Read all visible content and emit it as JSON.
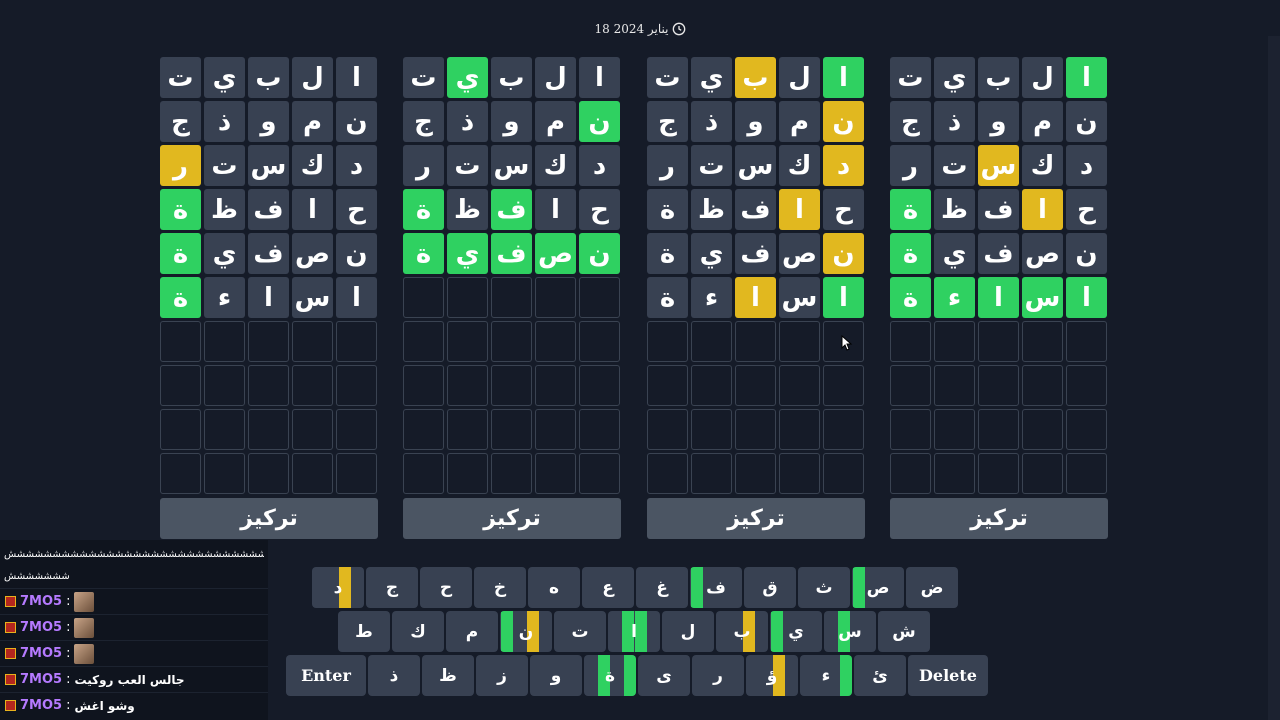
{
  "date": "18 يناير 2024",
  "focus_label": "تركيز",
  "boards": [
    {
      "rows": [
        [
          {
            "l": "ت",
            "s": "a"
          },
          {
            "l": "ي",
            "s": "a"
          },
          {
            "l": "ب",
            "s": "a"
          },
          {
            "l": "ل",
            "s": "a"
          },
          {
            "l": "ا",
            "s": "a"
          }
        ],
        [
          {
            "l": "ج",
            "s": "a"
          },
          {
            "l": "ذ",
            "s": "a"
          },
          {
            "l": "و",
            "s": "a"
          },
          {
            "l": "م",
            "s": "a"
          },
          {
            "l": "ن",
            "s": "a"
          }
        ],
        [
          {
            "l": "ر",
            "s": "y"
          },
          {
            "l": "ت",
            "s": "a"
          },
          {
            "l": "س",
            "s": "a"
          },
          {
            "l": "ك",
            "s": "a"
          },
          {
            "l": "د",
            "s": "a"
          }
        ],
        [
          {
            "l": "ة",
            "s": "g"
          },
          {
            "l": "ظ",
            "s": "a"
          },
          {
            "l": "ف",
            "s": "a"
          },
          {
            "l": "ا",
            "s": "a"
          },
          {
            "l": "ح",
            "s": "a"
          }
        ],
        [
          {
            "l": "ة",
            "s": "g"
          },
          {
            "l": "ي",
            "s": "a"
          },
          {
            "l": "ف",
            "s": "a"
          },
          {
            "l": "ص",
            "s": "a"
          },
          {
            "l": "ن",
            "s": "a"
          }
        ],
        [
          {
            "l": "ة",
            "s": "g"
          },
          {
            "l": "ء",
            "s": "a"
          },
          {
            "l": "ا",
            "s": "a"
          },
          {
            "l": "س",
            "s": "a"
          },
          {
            "l": "ا",
            "s": "a"
          }
        ]
      ]
    },
    {
      "rows": [
        [
          {
            "l": "ت",
            "s": "a"
          },
          {
            "l": "ي",
            "s": "g"
          },
          {
            "l": "ب",
            "s": "a"
          },
          {
            "l": "ل",
            "s": "a"
          },
          {
            "l": "ا",
            "s": "a"
          }
        ],
        [
          {
            "l": "ج",
            "s": "a"
          },
          {
            "l": "ذ",
            "s": "a"
          },
          {
            "l": "و",
            "s": "a"
          },
          {
            "l": "م",
            "s": "a"
          },
          {
            "l": "ن",
            "s": "g"
          }
        ],
        [
          {
            "l": "ر",
            "s": "a"
          },
          {
            "l": "ت",
            "s": "a"
          },
          {
            "l": "س",
            "s": "a"
          },
          {
            "l": "ك",
            "s": "a"
          },
          {
            "l": "د",
            "s": "a"
          }
        ],
        [
          {
            "l": "ة",
            "s": "g"
          },
          {
            "l": "ظ",
            "s": "a"
          },
          {
            "l": "ف",
            "s": "g"
          },
          {
            "l": "ا",
            "s": "a"
          },
          {
            "l": "ح",
            "s": "a"
          }
        ],
        [
          {
            "l": "ة",
            "s": "g"
          },
          {
            "l": "ي",
            "s": "g"
          },
          {
            "l": "ف",
            "s": "g"
          },
          {
            "l": "ص",
            "s": "g"
          },
          {
            "l": "ن",
            "s": "g"
          }
        ]
      ]
    },
    {
      "rows": [
        [
          {
            "l": "ت",
            "s": "a"
          },
          {
            "l": "ي",
            "s": "a"
          },
          {
            "l": "ب",
            "s": "y"
          },
          {
            "l": "ل",
            "s": "a"
          },
          {
            "l": "ا",
            "s": "g"
          }
        ],
        [
          {
            "l": "ج",
            "s": "a"
          },
          {
            "l": "ذ",
            "s": "a"
          },
          {
            "l": "و",
            "s": "a"
          },
          {
            "l": "م",
            "s": "a"
          },
          {
            "l": "ن",
            "s": "y"
          }
        ],
        [
          {
            "l": "ر",
            "s": "a"
          },
          {
            "l": "ت",
            "s": "a"
          },
          {
            "l": "س",
            "s": "a"
          },
          {
            "l": "ك",
            "s": "a"
          },
          {
            "l": "د",
            "s": "y"
          }
        ],
        [
          {
            "l": "ة",
            "s": "a"
          },
          {
            "l": "ظ",
            "s": "a"
          },
          {
            "l": "ف",
            "s": "a"
          },
          {
            "l": "ا",
            "s": "y"
          },
          {
            "l": "ح",
            "s": "a"
          }
        ],
        [
          {
            "l": "ة",
            "s": "a"
          },
          {
            "l": "ي",
            "s": "a"
          },
          {
            "l": "ف",
            "s": "a"
          },
          {
            "l": "ص",
            "s": "a"
          },
          {
            "l": "ن",
            "s": "y"
          }
        ],
        [
          {
            "l": "ة",
            "s": "a"
          },
          {
            "l": "ء",
            "s": "a"
          },
          {
            "l": "ا",
            "s": "y"
          },
          {
            "l": "س",
            "s": "a"
          },
          {
            "l": "ا",
            "s": "g"
          }
        ]
      ]
    },
    {
      "rows": [
        [
          {
            "l": "ت",
            "s": "a"
          },
          {
            "l": "ي",
            "s": "a"
          },
          {
            "l": "ب",
            "s": "a"
          },
          {
            "l": "ل",
            "s": "a"
          },
          {
            "l": "ا",
            "s": "g"
          }
        ],
        [
          {
            "l": "ج",
            "s": "a"
          },
          {
            "l": "ذ",
            "s": "a"
          },
          {
            "l": "و",
            "s": "a"
          },
          {
            "l": "م",
            "s": "a"
          },
          {
            "l": "ن",
            "s": "a"
          }
        ],
        [
          {
            "l": "ر",
            "s": "a"
          },
          {
            "l": "ت",
            "s": "a"
          },
          {
            "l": "س",
            "s": "y"
          },
          {
            "l": "ك",
            "s": "a"
          },
          {
            "l": "د",
            "s": "a"
          }
        ],
        [
          {
            "l": "ة",
            "s": "g"
          },
          {
            "l": "ظ",
            "s": "a"
          },
          {
            "l": "ف",
            "s": "a"
          },
          {
            "l": "ا",
            "s": "y"
          },
          {
            "l": "ح",
            "s": "a"
          }
        ],
        [
          {
            "l": "ة",
            "s": "g"
          },
          {
            "l": "ي",
            "s": "a"
          },
          {
            "l": "ف",
            "s": "a"
          },
          {
            "l": "ص",
            "s": "a"
          },
          {
            "l": "ن",
            "s": "a"
          }
        ],
        [
          {
            "l": "ة",
            "s": "g"
          },
          {
            "l": "ء",
            "s": "g"
          },
          {
            "l": "ا",
            "s": "g"
          },
          {
            "l": "س",
            "s": "g"
          },
          {
            "l": "ا",
            "s": "g"
          }
        ]
      ]
    }
  ],
  "keyboard": {
    "rows": [
      [
        {
          "l": "ض"
        },
        {
          "l": "ص",
          "h": [
            "g",
            "a",
            "a",
            "a"
          ]
        },
        {
          "l": "ث"
        },
        {
          "l": "ق"
        },
        {
          "l": "ف",
          "h": [
            "g",
            "a",
            "a",
            "a"
          ]
        },
        {
          "l": "غ"
        },
        {
          "l": "ع"
        },
        {
          "l": "ه"
        },
        {
          "l": "خ"
        },
        {
          "l": "ح"
        },
        {
          "l": "ج"
        },
        {
          "l": "د",
          "h": [
            "a",
            "a",
            "y",
            "a"
          ]
        }
      ],
      [
        {
          "l": "ش"
        },
        {
          "l": "س",
          "h": [
            "a",
            "g",
            "a",
            "a"
          ]
        },
        {
          "l": "ي",
          "h": [
            "g",
            "a",
            "a",
            "a"
          ]
        },
        {
          "l": "ب",
          "h": [
            "a",
            "a",
            "y",
            "a"
          ]
        },
        {
          "l": "ل"
        },
        {
          "l": "ا",
          "h": [
            "a",
            "g",
            "g",
            "a"
          ]
        },
        {
          "l": "ت"
        },
        {
          "l": "ن",
          "h": [
            "g",
            "a",
            "y",
            "a"
          ]
        },
        {
          "l": "م"
        },
        {
          "l": "ك"
        },
        {
          "l": "ط"
        }
      ],
      [
        {
          "l": "Delete",
          "wide": true
        },
        {
          "l": "ئ"
        },
        {
          "l": "ء",
          "h": [
            "a",
            "a",
            "a",
            "g"
          ]
        },
        {
          "l": "ؤ",
          "h": [
            "a",
            "a",
            "y",
            "a"
          ]
        },
        {
          "l": "ر"
        },
        {
          "l": "ى"
        },
        {
          "l": "ة",
          "h": [
            "a",
            "g",
            "a",
            "g"
          ]
        },
        {
          "l": "و"
        },
        {
          "l": "ز"
        },
        {
          "l": "ظ"
        },
        {
          "l": "ذ"
        },
        {
          "l": "Enter",
          "wide": true
        }
      ]
    ]
  },
  "chat": {
    "header_line1": "ششششششششششششششششششششششششششششش",
    "header_line2": "ششششششش",
    "messages": [
      {
        "user": "7MO5",
        "sep": ":",
        "text": "",
        "emote": true
      },
      {
        "user": "7MO5",
        "sep": ":",
        "text": "",
        "emote": true
      },
      {
        "user": "7MO5",
        "sep": ":",
        "text": "",
        "emote": true
      },
      {
        "user": "7MO5",
        "sep": ":",
        "text": "جالس العب روكيت",
        "emote": false
      },
      {
        "user": "7MO5",
        "sep": ":",
        "text": "وشو اغش",
        "emote": false
      }
    ]
  },
  "colors": {
    "correct": "#2fd161",
    "present": "#e1b81f",
    "absent": "#384152",
    "bg": "#151b28"
  }
}
